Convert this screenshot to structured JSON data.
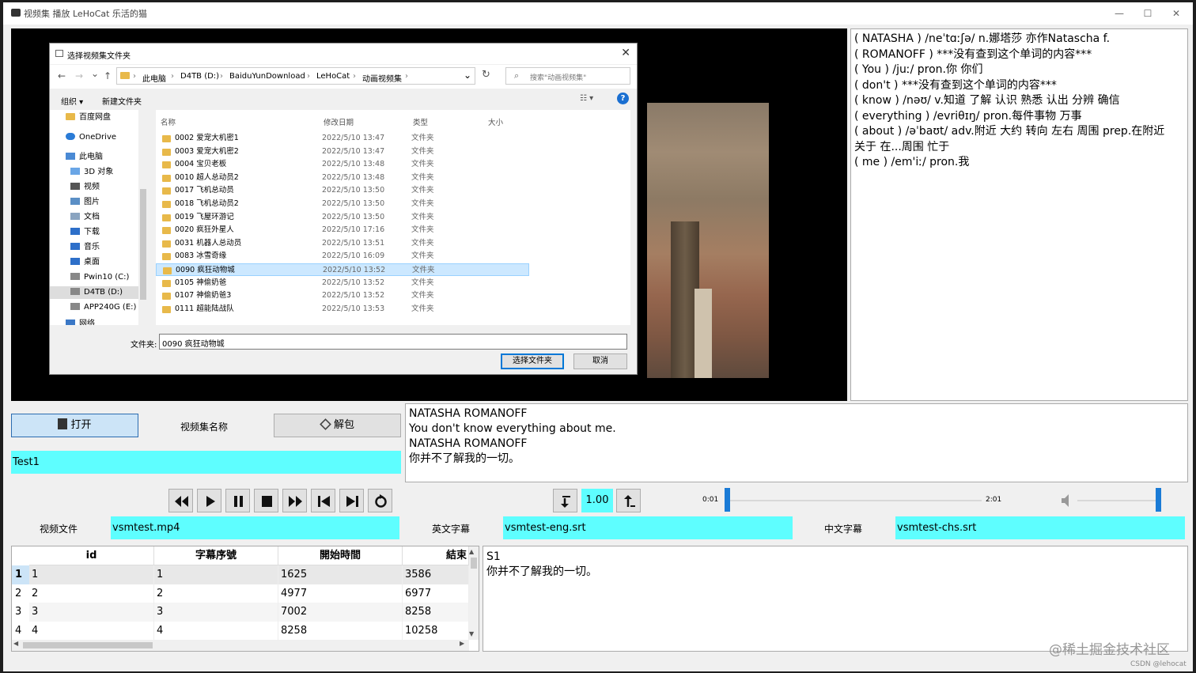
{
  "window": {
    "title": "视频集 播放  LeHoCat 乐活的猫",
    "min": "—",
    "max": "☐",
    "close": "✕"
  },
  "dictionary": {
    "lines": [
      "( NATASHA ) /neˈtɑːʃə/ n.娜塔莎 亦作Natascha f.",
      "( ROMANOFF ) ***没有查到这个单词的内容***",
      "( You ) /juː/  pron.你 你们",
      "( don't ) ***没有查到这个单词的内容***",
      "( know ) /nəʊ/ v.知道 了解 认识 熟悉 认出 分辨 确信",
      "( everything ) /evriθɪŋ/  pron.每件事物 万事",
      "( about ) /əˈbaʊt/ adv.附近 大约 转向 左右 周围 prep.在附近",
      "关于 在...周围 忙于",
      "( me ) /em'iː/  pron.我"
    ]
  },
  "dialog": {
    "title": "选择视频集文件夹",
    "close": "✕",
    "nav": {
      "back": "←",
      "forward": "→",
      "down": "⌄",
      "up": "↑",
      "refresh": "↻",
      "dropdown": "⌄"
    },
    "breadcrumb": [
      "此电脑",
      "D4TB (D:)",
      "BaiduYunDownload",
      "LeHoCat",
      "动画视频集"
    ],
    "breadcrumb_sep": "›",
    "search_placeholder": "搜索\"动画视频集\"",
    "toolbar": {
      "organize": "组织 ▾",
      "new_folder": "新建文件夹",
      "view": "☷ ▾",
      "help": "?"
    },
    "tree": [
      {
        "label": "百度网盘",
        "icon": "folder-icon"
      },
      {
        "label": "OneDrive",
        "icon": "cloud-icon"
      },
      {
        "label": "此电脑",
        "icon": "computer-icon"
      },
      {
        "label": "3D 对象",
        "icon": "cube-icon"
      },
      {
        "label": "视频",
        "icon": "video-icon"
      },
      {
        "label": "图片",
        "icon": "picture-icon"
      },
      {
        "label": "文档",
        "icon": "document-icon"
      },
      {
        "label": "下载",
        "icon": "download-icon"
      },
      {
        "label": "音乐",
        "icon": "music-icon"
      },
      {
        "label": "桌面",
        "icon": "desktop-icon"
      },
      {
        "label": "Pwin10 (C:)",
        "icon": "drive-icon"
      },
      {
        "label": "D4TB (D:)",
        "icon": "drive-icon"
      },
      {
        "label": "APP240G (E:)",
        "icon": "drive-icon"
      },
      {
        "label": "网络",
        "icon": "network-icon"
      }
    ],
    "columns": {
      "name": "名称",
      "date": "修改日期",
      "type": "类型",
      "size": "大小"
    },
    "files": [
      {
        "name": "0002 爱宠大机密1",
        "date": "2022/5/10 13:47",
        "type": "文件夹"
      },
      {
        "name": "0003 爱宠大机密2",
        "date": "2022/5/10 13:47",
        "type": "文件夹"
      },
      {
        "name": "0004 宝贝老板",
        "date": "2022/5/10 13:48",
        "type": "文件夹"
      },
      {
        "name": "0010 超人总动员2",
        "date": "2022/5/10 13:48",
        "type": "文件夹"
      },
      {
        "name": "0017 飞机总动员",
        "date": "2022/5/10 13:50",
        "type": "文件夹"
      },
      {
        "name": "0018 飞机总动员2",
        "date": "2022/5/10 13:50",
        "type": "文件夹"
      },
      {
        "name": "0019 飞屋环游记",
        "date": "2022/5/10 13:50",
        "type": "文件夹"
      },
      {
        "name": "0020 疯狂外星人",
        "date": "2022/5/10 17:16",
        "type": "文件夹"
      },
      {
        "name": "0031 机器人总动员",
        "date": "2022/5/10 13:51",
        "type": "文件夹"
      },
      {
        "name": "0083 冰雪奇缘",
        "date": "2022/5/10 16:09",
        "type": "文件夹"
      },
      {
        "name": "0090 疯狂动物城",
        "date": "2022/5/10 13:52",
        "type": "文件夹"
      },
      {
        "name": "0105 神偷奶爸",
        "date": "2022/5/10 13:52",
        "type": "文件夹"
      },
      {
        "name": "0107 神偷奶爸3",
        "date": "2022/5/10 13:52",
        "type": "文件夹"
      },
      {
        "name": "0111 超能陆战队",
        "date": "2022/5/10 13:53",
        "type": "文件夹"
      }
    ],
    "selected_index": 10,
    "folder_label": "文件夹:",
    "folder_value": "0090 疯狂动物城",
    "select_button": "选择文件夹",
    "cancel_button": "取消"
  },
  "controls": {
    "open_button": "打开",
    "collection_name_label": "视频集名称",
    "unpack_button": "解包",
    "collection_name": "Test1",
    "speed": "1.00",
    "time_current": "0:01",
    "time_total": "2:01",
    "progress_fraction": 0.0,
    "volume_fraction": 1.0
  },
  "subtitle_display": {
    "lines": [
      "NATASHA ROMANOFF",
      "You don't know everything about me.",
      "NATASHA ROMANOFF",
      "你并不了解我的一切。"
    ]
  },
  "files_row": {
    "video_label": "视频文件",
    "video_value": "vsmtest.mp4",
    "eng_label": "英文字幕",
    "eng_value": "vsmtest-eng.srt",
    "chs_label": "中文字幕",
    "chs_value": "vsmtest-chs.srt"
  },
  "table": {
    "headers": [
      "id",
      "字幕序號",
      "開始時間",
      "結束"
    ],
    "rows": [
      {
        "row": "1",
        "cells": [
          "1",
          "1",
          "1625",
          "3586"
        ]
      },
      {
        "row": "2",
        "cells": [
          "2",
          "2",
          "4977",
          "6977"
        ]
      },
      {
        "row": "3",
        "cells": [
          "3",
          "3",
          "7002",
          "8258"
        ]
      },
      {
        "row": "4",
        "cells": [
          "4",
          "4",
          "8258",
          "10258"
        ]
      }
    ]
  },
  "detail": {
    "lines": [
      "S1",
      "你并不了解我的一切。"
    ]
  },
  "watermarks": {
    "main": "@稀土掘金技术社区",
    "small": "CSDN @lehocat"
  }
}
